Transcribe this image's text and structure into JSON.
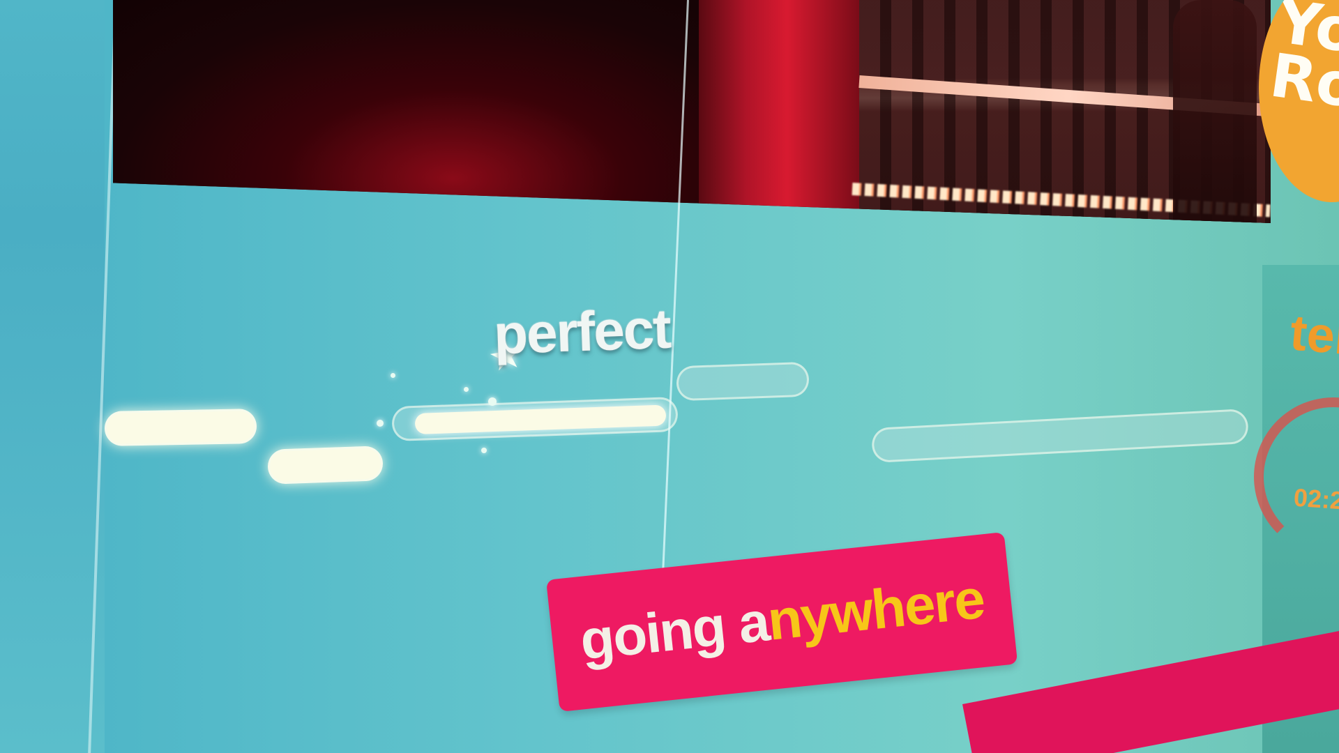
{
  "logo": {
    "text": "Yo\nRo"
  },
  "feedback": {
    "label": "perfect"
  },
  "lyrics": {
    "sung": "going a",
    "upcoming": "nywhere"
  },
  "right_panel": {
    "label": "ter",
    "timer": "02:2"
  },
  "colors": {
    "accent_pink": "#ee1a62",
    "lyric_highlight": "#f7c619",
    "panel_teal": "#63c4cc",
    "logo_orange": "#f2a531"
  }
}
